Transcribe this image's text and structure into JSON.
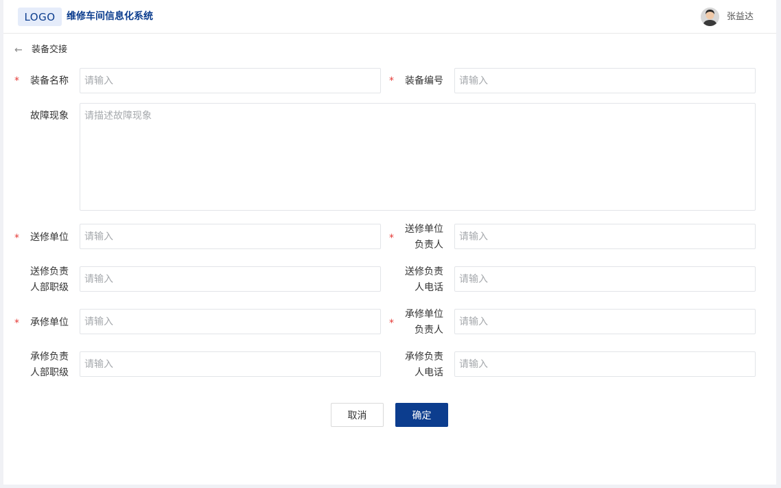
{
  "header": {
    "logo": "LOGO",
    "app_title": "维修车间信息化系统",
    "user_name": "张益达"
  },
  "breadcrumb": {
    "back_icon": "←",
    "title": "装备交接"
  },
  "form": {
    "required_mark": "*",
    "equipment_name": {
      "label": "装备名称",
      "placeholder": "请输入"
    },
    "equipment_no": {
      "label": "装备编号",
      "placeholder": "请输入"
    },
    "fault": {
      "label": "故障现象",
      "placeholder": "请描述故障现象"
    },
    "send_unit": {
      "label": "送修单位",
      "placeholder": "请输入"
    },
    "send_unit_leader": {
      "label_line1": "送修单位",
      "label_line2": "负责人",
      "placeholder": "请输入"
    },
    "send_leader_rank": {
      "label_line1": "送修负责",
      "label_line2": "人部职级",
      "placeholder": "请输入"
    },
    "send_leader_phone": {
      "label_line1": "送修负责",
      "label_line2": "人电话",
      "placeholder": "请输入"
    },
    "repair_unit": {
      "label": "承修单位",
      "placeholder": "请输入"
    },
    "repair_unit_leader": {
      "label_line1": "承修单位",
      "label_line2": "负责人",
      "placeholder": "请输入"
    },
    "repair_leader_rank": {
      "label_line1": "承修负责",
      "label_line2": "人部职级",
      "placeholder": "请输入"
    },
    "repair_leader_phone": {
      "label_line1": "承修负责",
      "label_line2": "人电话",
      "placeholder": "请输入"
    }
  },
  "actions": {
    "cancel": "取消",
    "confirm": "确定"
  },
  "colors": {
    "brand": "#0c3d8e",
    "required": "#e53935"
  }
}
